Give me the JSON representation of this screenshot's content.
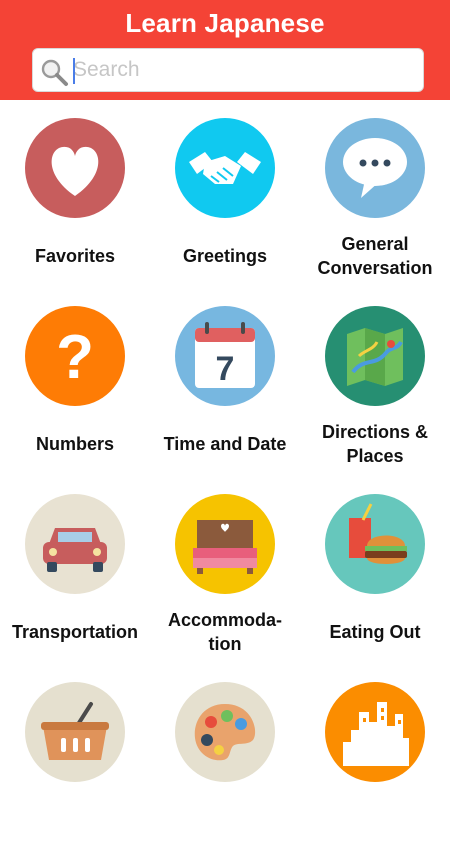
{
  "header": {
    "title": "Learn Japanese"
  },
  "search": {
    "placeholder": "Search",
    "value": ""
  },
  "categories": [
    {
      "label": "Favorites",
      "icon": "heart-icon",
      "color": "#c75d5d"
    },
    {
      "label": "Greetings",
      "icon": "handshake-icon",
      "color": "#10c9f0"
    },
    {
      "label": "General\nConversation",
      "icon": "speech-bubble-icon",
      "color": "#7ab7dd"
    },
    {
      "label": "Numbers",
      "icon": "question-mark-icon",
      "color": "#fe7c05"
    },
    {
      "label": "Time and Date",
      "icon": "calendar-icon",
      "color": "#77b7e0"
    },
    {
      "label": "Directions &\nPlaces",
      "icon": "map-icon",
      "color": "#268f72"
    },
    {
      "label": "Transportation",
      "icon": "car-icon",
      "color": "#e8e2d2"
    },
    {
      "label": "Accommoda-\ntion",
      "icon": "bed-icon",
      "color": "#f6c300"
    },
    {
      "label": "Eating Out",
      "icon": "burger-icon",
      "color": "#66c7bc"
    },
    {
      "label": "",
      "icon": "shopping-basket-icon",
      "color": "#e5e0cf"
    },
    {
      "label": "",
      "icon": "palette-icon",
      "color": "#e5e0cf"
    },
    {
      "label": "",
      "icon": "city-icon",
      "color": "#fb8d00"
    }
  ]
}
